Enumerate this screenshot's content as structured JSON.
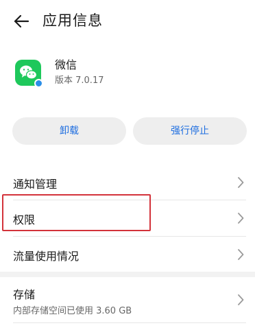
{
  "header": {
    "back_icon": "arrow-left-icon",
    "title": "应用信息"
  },
  "app": {
    "icon": "wechat-icon",
    "name": "微信",
    "version": "版本 7.0.17"
  },
  "actions": {
    "uninstall_label": "卸载",
    "force_stop_label": "强行停止"
  },
  "settings": {
    "items": [
      {
        "label": "通知管理"
      },
      {
        "label": "权限"
      },
      {
        "label": "流量使用情况"
      }
    ],
    "storage": {
      "label": "存储",
      "detail": "内部存储空间已使用 3.60 GB"
    }
  },
  "colors": {
    "accent": "#1e6ee0",
    "app_icon_bg": "#1ec85b",
    "highlight": "#d3323a"
  }
}
